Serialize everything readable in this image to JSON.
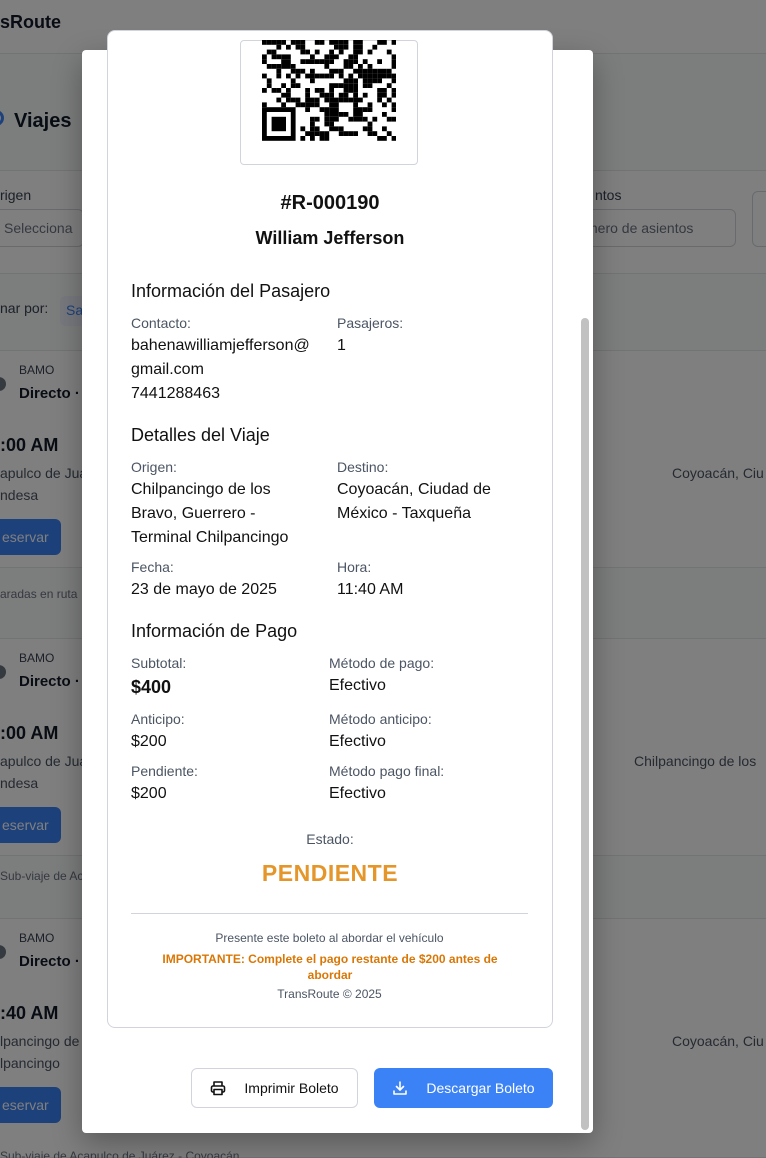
{
  "background": {
    "brand": "sRoute",
    "page_title": "Viajes",
    "filters": {
      "origin_label": "rigen",
      "origin_placeholder": "Selecciona",
      "seats_label": "ntos",
      "seats_placeholder": "mero de asientos"
    },
    "sort_label": "nar por:",
    "sort_chip": "Sa",
    "cards": [
      {
        "operator": "BAMO",
        "kind": "Directo · (",
        "time": ":00 AM",
        "origin_l1": "apulco de Jua",
        "origin_l2": "ndesa",
        "destination": "Coyoacán, Ciu",
        "button": "eservar",
        "footer": "aradas en ruta"
      },
      {
        "operator": "BAMO",
        "kind": "Directo · (",
        "time": ":00 AM",
        "origin_l1": "apulco de Jua",
        "origin_l2": "ndesa",
        "destination": "Chilpancingo de los",
        "button": "eservar",
        "footer": "Sub-viaje de Ac"
      },
      {
        "operator": "BAMO",
        "kind": "Directo · .",
        "time": ":40 AM",
        "origin_l1": "lpancingo de",
        "origin_l2": "lpancingo",
        "destination": "Coyoacán, Ciu",
        "button": "eservar",
        "footer": "Sub-viaje de Acapulco de Juárez - Coyoacán"
      }
    ]
  },
  "ticket": {
    "reservation_id": "#R-000190",
    "passenger_name": "William Jefferson",
    "passenger_section": {
      "title": "Información del Pasajero",
      "contact_label": "Contacto:",
      "email_line1": "bahenawilliamjefferson@",
      "email_line2": "gmail.com",
      "phone": "7441288463",
      "passengers_label": "Pasajeros:",
      "passengers_value": "1"
    },
    "trip_section": {
      "title": "Detalles del Viaje",
      "origin_label": "Origen:",
      "origin_l1": "Chilpancingo de los",
      "origin_l2": "Bravo, Guerrero -",
      "origin_l3": "Terminal Chilpancingo",
      "destination_label": "Destino:",
      "destination_l1": "Coyoacán, Ciudad de",
      "destination_l2": "México - Taxqueña",
      "date_label": "Fecha:",
      "date_value": "23 de mayo de 2025",
      "time_label": "Hora:",
      "time_value": "11:40 AM"
    },
    "payment_section": {
      "title": "Información de Pago",
      "subtotal_label": "Subtotal:",
      "subtotal_value": "$400",
      "method_label": "Método de pago:",
      "method_value": "Efectivo",
      "advance_label": "Anticipo:",
      "advance_value": "$200",
      "advance_method_label": "Método anticipo:",
      "advance_method_value": "Efectivo",
      "pending_label": "Pendiente:",
      "pending_value": "$200",
      "final_method_label": "Método pago final:",
      "final_method_value": "Efectivo"
    },
    "status_label": "Estado:",
    "status_value": "PENDIENTE",
    "status_color": "#e5962a",
    "footer_note": "Presente este boleto al abordar el vehículo",
    "important_l1": "IMPORTANTE: Complete el pago restante de $200 antes de",
    "important_l2": "abordar",
    "copyright": "TransRoute © 2025"
  },
  "actions": {
    "print_label": "Imprimir Boleto",
    "print_icon": "printer-icon",
    "download_label": "Descargar Boleto",
    "download_icon": "download-icon",
    "accent_color": "#3b82f6"
  }
}
